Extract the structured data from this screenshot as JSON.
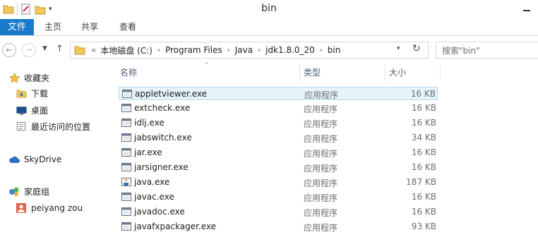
{
  "window": {
    "title": "bin"
  },
  "ribbon": {
    "tabs": [
      {
        "label": "文件"
      },
      {
        "label": "主页"
      },
      {
        "label": "共享"
      },
      {
        "label": "查看"
      }
    ]
  },
  "address": {
    "prefix": "«",
    "crumbs": [
      "本地磁盘 (C:)",
      "Program Files",
      "Java",
      "jdk1.8.0_20",
      "bin"
    ]
  },
  "search": {
    "placeholder": "搜索\"bin\""
  },
  "nav": {
    "favorites": "收藏夹",
    "download": "下载",
    "desktop": "桌面",
    "recent": "最近访问的位置",
    "skydrive": "SkyDrive",
    "homegroup": "家庭组",
    "user": "peiyang zou"
  },
  "columns": {
    "name": "名称",
    "type": "类型",
    "size": "大小"
  },
  "files": [
    {
      "name": "appletviewer.exe",
      "type": "应用程序",
      "size": "16 KB",
      "icon": "exe-window-icon",
      "selected": true
    },
    {
      "name": "extcheck.exe",
      "type": "应用程序",
      "size": "16 KB",
      "icon": "exe-window-icon"
    },
    {
      "name": "idlj.exe",
      "type": "应用程序",
      "size": "16 KB",
      "icon": "exe-window-icon"
    },
    {
      "name": "jabswitch.exe",
      "type": "应用程序",
      "size": "34 KB",
      "icon": "exe-window-icon"
    },
    {
      "name": "jar.exe",
      "type": "应用程序",
      "size": "16 KB",
      "icon": "exe-window-icon"
    },
    {
      "name": "jarsigner.exe",
      "type": "应用程序",
      "size": "16 KB",
      "icon": "exe-window-icon"
    },
    {
      "name": "java.exe",
      "type": "应用程序",
      "size": "187 KB",
      "icon": "java-icon"
    },
    {
      "name": "javac.exe",
      "type": "应用程序",
      "size": "16 KB",
      "icon": "exe-window-icon"
    },
    {
      "name": "javadoc.exe",
      "type": "应用程序",
      "size": "16 KB",
      "icon": "exe-window-icon"
    },
    {
      "name": "javafxpackager.exe",
      "type": "应用程序",
      "size": "93 KB",
      "icon": "exe-window-icon"
    }
  ],
  "colors": {
    "accent": "#1979ca",
    "selection": "#e5f3fb",
    "selection_border": "#b7def6"
  }
}
